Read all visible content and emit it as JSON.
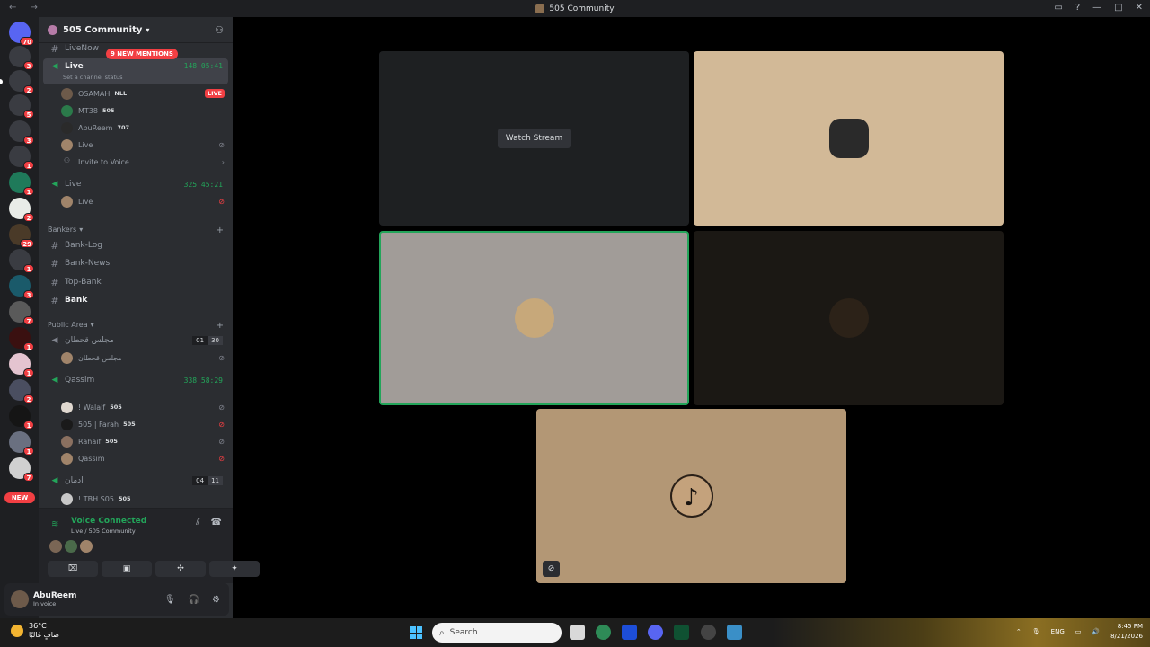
{
  "window": {
    "title": "505 Community",
    "nav": "← →"
  },
  "rail": {
    "badges": [
      "70",
      "3",
      "2",
      "5",
      "3",
      "1",
      "1",
      "2",
      "29",
      "1",
      "3",
      "7",
      "1",
      "1",
      "2",
      "1",
      "1",
      "7"
    ],
    "new_label": "NEW"
  },
  "server": {
    "name": "505 Community"
  },
  "mentions_label": "9 NEW MENTIONS",
  "channels": {
    "livenow": "LiveNow",
    "live1": {
      "name": "Live",
      "status": "Set a channel status",
      "timer": "148:05:41"
    },
    "live1_users": [
      {
        "name": "OSAMAH",
        "tag": "NLL",
        "live": "LIVE"
      },
      {
        "name": "MT38",
        "tag": "505"
      },
      {
        "name": "AbuReem",
        "tag": "707"
      },
      {
        "name": "Live"
      }
    ],
    "invite": "Invite to Voice",
    "live2": {
      "name": "Live",
      "timer": "325:45:21"
    },
    "live2_users": [
      {
        "name": "Live"
      }
    ],
    "bankers": {
      "label": "Bankers",
      "items": [
        "Bank-Log",
        "Bank-News",
        "Top-Bank",
        "Bank"
      ]
    },
    "public": {
      "label": "Public Area",
      "majlis": {
        "name": "مجلس قحطان",
        "count": [
          "01",
          "30"
        ]
      },
      "majlis_user": "مجلس قحطان",
      "qassim": {
        "name": "Qassim",
        "timer": "338:58:29"
      },
      "qassim_users": [
        {
          "name": "! Walaif",
          "tag": "505"
        },
        {
          "name": "505 | Farah",
          "tag": "505"
        },
        {
          "name": "Rahaif",
          "tag": "505"
        },
        {
          "name": "Qassim"
        }
      ],
      "edman": {
        "name": "ادمان",
        "count": [
          "04",
          "11"
        ]
      },
      "edman_user": {
        "name": "! TBH S05",
        "tag": "505"
      }
    }
  },
  "voice": {
    "title": "Voice Connected",
    "sub": "Live / 505 Community"
  },
  "user": {
    "name": "AbuReem",
    "status": "In voice"
  },
  "stage": {
    "watch": "Watch Stream"
  },
  "taskbar": {
    "temp": "36°C",
    "weather": "صافٍ غالبًا",
    "search": "Search",
    "lang": "ENG",
    "time": "8:45 PM",
    "date": "8/21/2026"
  },
  "colors": {
    "accent": "#23a55a",
    "danger": "#f23f43",
    "sidebar": "#2b2d31"
  }
}
